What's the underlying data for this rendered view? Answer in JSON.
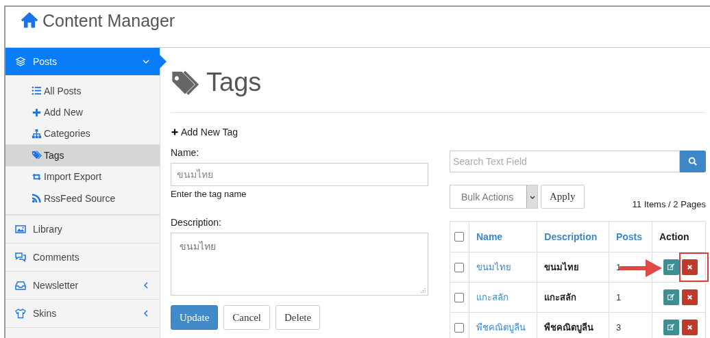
{
  "app": {
    "title": "Content Manager"
  },
  "sidebar": {
    "items": [
      {
        "label": "Posts",
        "selected": true,
        "expanded": true,
        "children": [
          {
            "label": "All Posts",
            "selected": false
          },
          {
            "label": "Add New",
            "selected": false
          },
          {
            "label": "Categories",
            "selected": false
          },
          {
            "label": "Tags",
            "selected": true
          },
          {
            "label": "Import Export",
            "selected": false
          },
          {
            "label": "RssFeed Source",
            "selected": false
          }
        ]
      },
      {
        "label": "Library",
        "selected": false
      },
      {
        "label": "Comments",
        "selected": false
      },
      {
        "label": "Newsletter",
        "selected": false,
        "expanded": false
      },
      {
        "label": "Skins",
        "selected": false,
        "expanded": false
      }
    ]
  },
  "page": {
    "heading": "Tags",
    "add_link": "Add New Tag"
  },
  "form": {
    "name_label": "Name:",
    "name_value": "ขนมไทย",
    "name_hint": "Enter the tag name",
    "description_label": "Description:",
    "description_value": "ขนมไทย",
    "buttons": [
      {
        "label": "Update",
        "kind": "primary"
      },
      {
        "label": "Cancel",
        "kind": "default"
      },
      {
        "label": "Delete",
        "kind": "default"
      }
    ]
  },
  "list": {
    "search_placeholder": "Search Text Field",
    "bulk_select": "Bulk Actions",
    "apply": "Apply",
    "count": "11 Items / 2 Pages",
    "table": {
      "select_all_checked": false,
      "columns": [
        "Name",
        "Description",
        "Posts",
        "Action"
      ],
      "rows": [
        {
          "checked": false,
          "name": "ขนมไทย",
          "description": "ขนมไทย",
          "posts": "1",
          "highlighted": true
        },
        {
          "checked": false,
          "name": "แกะสลัก",
          "description": "แกะสลัก",
          "posts": "1",
          "highlighted": false
        },
        {
          "checked": false,
          "name": "พืชคณิตบูลีน",
          "description": "พืชคณิตบูลีน",
          "posts": "3",
          "highlighted": false
        }
      ]
    }
  }
}
